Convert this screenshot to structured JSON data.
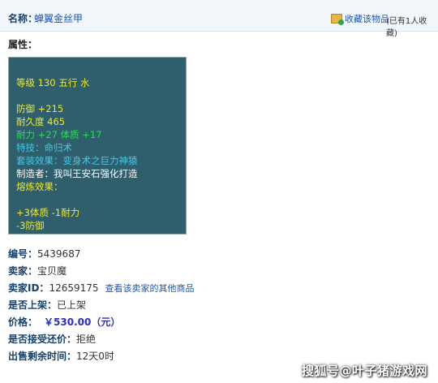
{
  "header": {
    "name_label": "名称：",
    "item_name": "蝉翼金丝甲",
    "favorite_label": "收藏该物品",
    "favorite_count": "(已有1人收藏)"
  },
  "attributes": {
    "title": "属性：",
    "lines": [
      {
        "text": "等级 130 五行 水",
        "color": "#f2ea2a"
      },
      {
        "text": "防御 +215",
        "color": "#f2ea2a"
      },
      {
        "text": "耐久度 465",
        "color": "#f2ea2a"
      },
      {
        "text": "耐力 +27 体质 +17",
        "color": "#20e648"
      },
      {
        "text": "特技：命归术",
        "color": "#45c8e6"
      },
      {
        "text": "套装效果：变身术之巨力神猿",
        "color": "#45c8e6"
      },
      {
        "text": "制造者：我叫王安石强化打造",
        "color": "#ffffff"
      },
      {
        "text": "熔炼效果：",
        "color": "#f2ea2a"
      },
      {
        "text": "+3体质 -1耐力",
        "color": "#f2ea2a"
      },
      {
        "text": "-3防御",
        "color": "#f2ea2a"
      }
    ]
  },
  "details": {
    "id_label": "编号：",
    "id_value": "5439687",
    "seller_label": "卖家：",
    "seller_value": "宝贝魔",
    "seller_id_label": "卖家ID：",
    "seller_id_value": "12659175",
    "seller_link": "查看该卖家的其他商品",
    "listed_label": "是否上架：",
    "listed_value": "已上架",
    "price_label": "价格：",
    "price_value": "￥530.00（元）",
    "counter_label": "是否接受还价：",
    "counter_value": "拒绝",
    "remaining_label": "出售剩余时间：",
    "remaining_value": "12天0时"
  },
  "watermark": "搜狐号@叶子猪游戏网",
  "colors": {
    "header_bg": "#f1f6fb",
    "link": "#1a57b7",
    "label": "#14406a",
    "panel_bg": "#2f5e6c",
    "price": "#2c2cd0"
  },
  "icons": {
    "favorite": "folder-add-icon"
  }
}
